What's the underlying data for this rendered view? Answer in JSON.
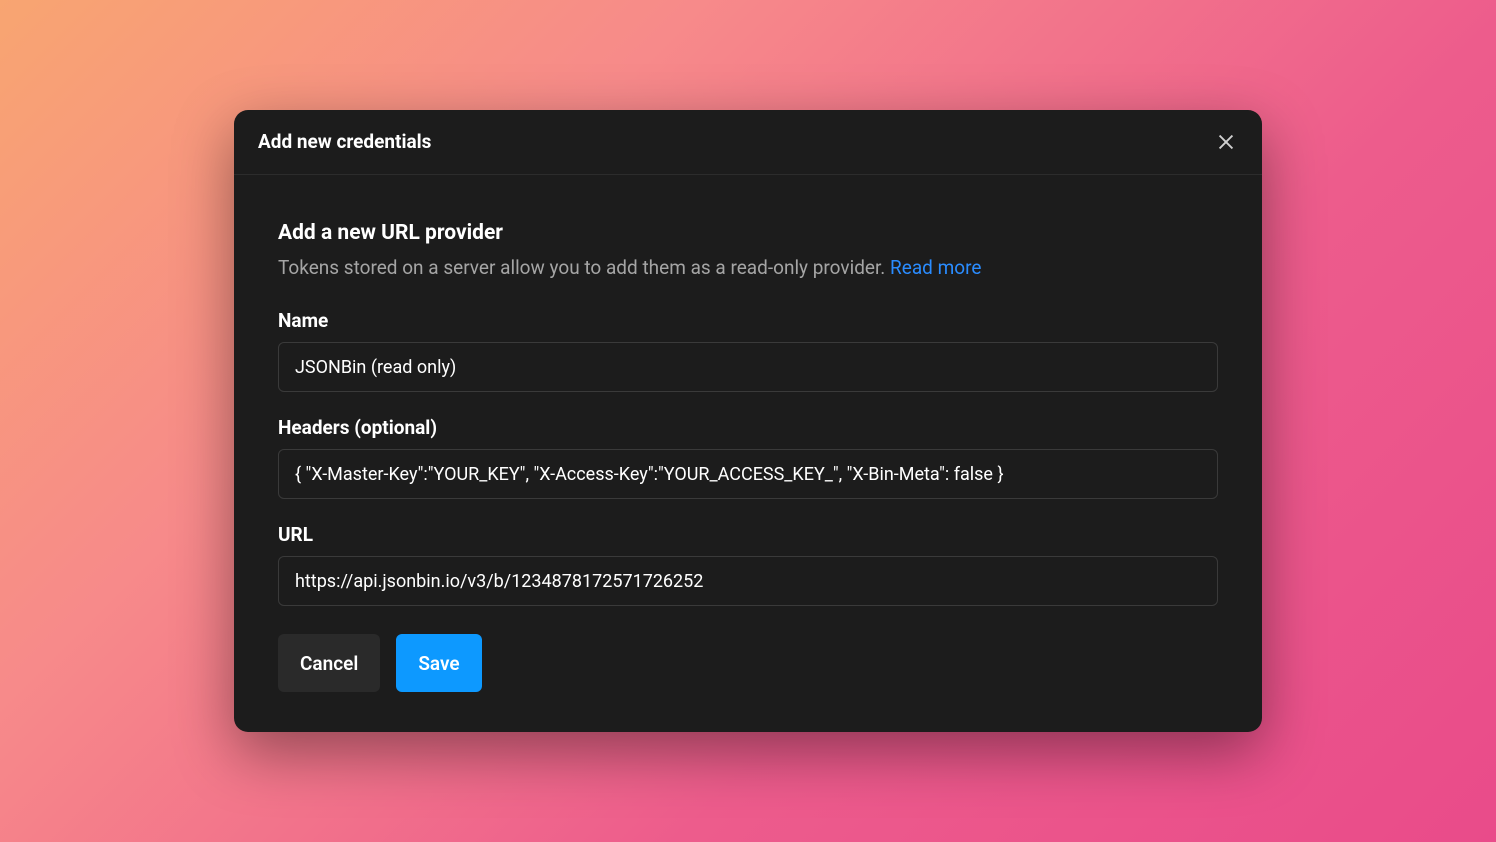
{
  "modal": {
    "title": "Add new credentials",
    "section_title": "Add a new URL provider",
    "description": "Tokens stored on a server allow you to add them as a read-only provider. ",
    "read_more": "Read more",
    "fields": {
      "name": {
        "label": "Name",
        "value": "JSONBin (read only)"
      },
      "headers": {
        "label": "Headers (optional)",
        "value": "{ \"X-Master-Key\":\"YOUR_KEY\", \"X-Access-Key\":\"YOUR_ACCESS_KEY_\", \"X-Bin-Meta\": false }"
      },
      "url": {
        "label": "URL",
        "value": "https://api.jsonbin.io/v3/b/1234878172571726252"
      }
    },
    "buttons": {
      "cancel": "Cancel",
      "save": "Save"
    }
  }
}
